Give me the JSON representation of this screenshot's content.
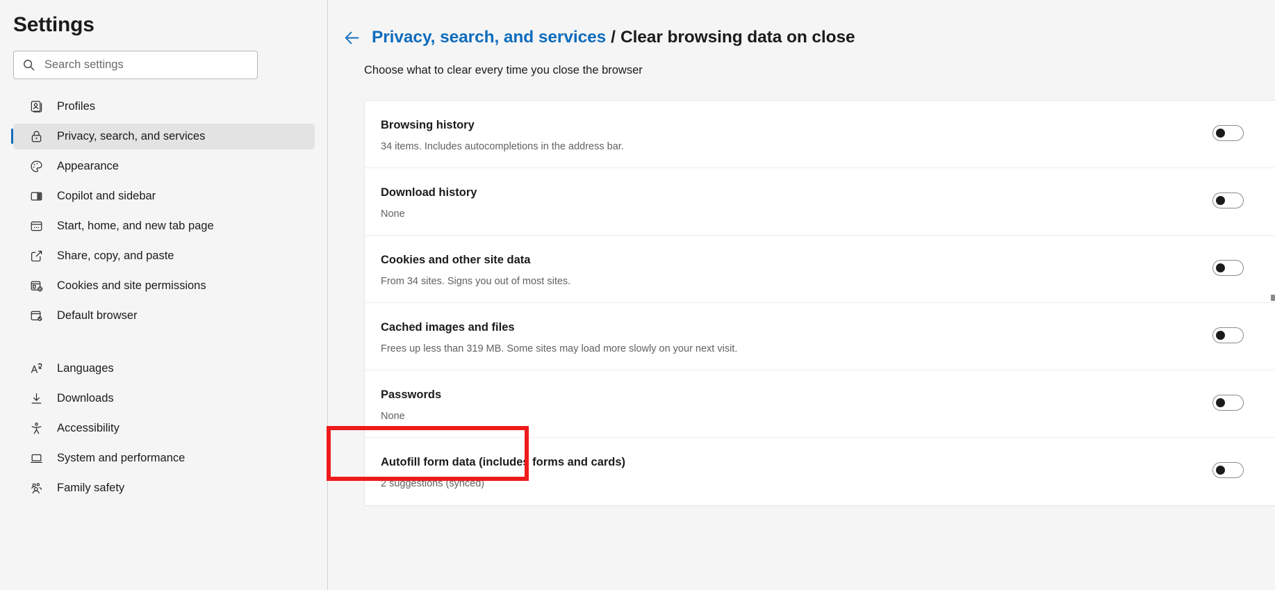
{
  "sidebar": {
    "title": "Settings",
    "search": {
      "placeholder": "Search settings",
      "value": "",
      "icon": "search-icon"
    },
    "items": [
      {
        "label": "Profiles",
        "icon": "profiles-icon",
        "selected": false
      },
      {
        "label": "Privacy, search, and services",
        "icon": "lock-icon",
        "selected": true
      },
      {
        "label": "Appearance",
        "icon": "palette-icon",
        "selected": false
      },
      {
        "label": "Copilot and sidebar",
        "icon": "sidebar-panel-icon",
        "selected": false
      },
      {
        "label": "Start, home, and new tab page",
        "icon": "home-page-icon",
        "selected": false
      },
      {
        "label": "Share, copy, and paste",
        "icon": "share-icon",
        "selected": false
      },
      {
        "label": "Cookies and site permissions",
        "icon": "cookies-permissions-icon",
        "selected": false
      },
      {
        "label": "Default browser",
        "icon": "default-browser-icon",
        "selected": false
      },
      {
        "label": "Languages",
        "icon": "languages-icon",
        "selected": false
      },
      {
        "label": "Downloads",
        "icon": "download-icon",
        "selected": false
      },
      {
        "label": "Accessibility",
        "icon": "accessibility-icon",
        "selected": false
      },
      {
        "label": "System and performance",
        "icon": "laptop-icon",
        "selected": false
      },
      {
        "label": "Family safety",
        "icon": "family-icon",
        "selected": false
      }
    ]
  },
  "main": {
    "back_icon": "back-arrow-icon",
    "breadcrumb_parent": "Privacy, search, and services",
    "breadcrumb_separator": "/",
    "breadcrumb_current": "Clear browsing data on close",
    "subtitle": "Choose what to clear every time you close the browser",
    "rows": [
      {
        "title": "Browsing history",
        "desc": "34 items. Includes autocompletions in the address bar.",
        "toggle_on": false
      },
      {
        "title": "Download history",
        "desc": "None",
        "toggle_on": false
      },
      {
        "title": "Cookies and other site data",
        "desc": "From 34 sites. Signs you out of most sites.",
        "toggle_on": false
      },
      {
        "title": "Cached images and files",
        "desc": "Frees up less than 319 MB. Some sites may load more slowly on your next visit.",
        "toggle_on": false
      },
      {
        "title": "Passwords",
        "desc": "None",
        "toggle_on": false
      },
      {
        "title": "Autofill form data (includes forms and cards)",
        "desc": "2 suggestions (synced)",
        "toggle_on": false
      }
    ]
  },
  "annotation": {
    "highlight_color": "#ee1b1b",
    "highlight_target": "Passwords"
  },
  "colors": {
    "accent": "#0f6cbd",
    "background": "#f5f5f5",
    "card": "#ffffff",
    "text": "#1b1b1b",
    "muted": "#616161"
  }
}
